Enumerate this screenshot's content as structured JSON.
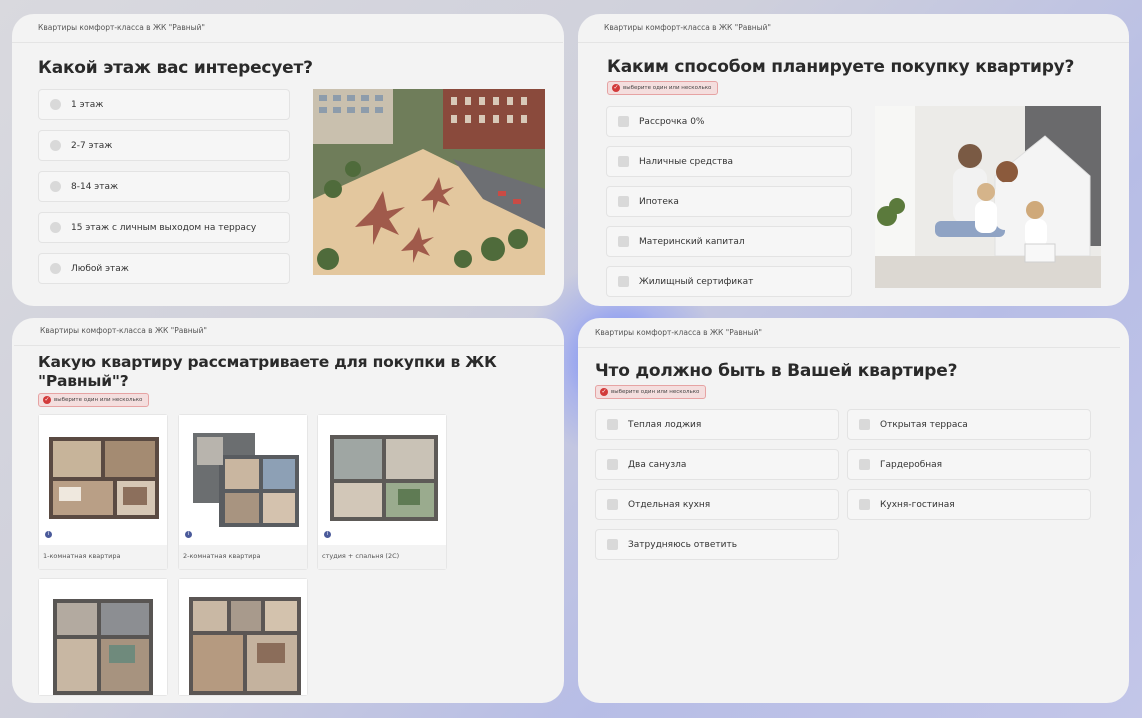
{
  "card1": {
    "breadcrumb": "Квартиры комфорт-класса в ЖК \"Равный\"",
    "title": "Какой этаж вас интересует?",
    "options": [
      "1 этаж",
      "2-7 этаж",
      "8-14 этаж",
      "15 этаж с личным выходом на террасу",
      "Любой этаж"
    ]
  },
  "card2": {
    "breadcrumb": "Квартиры комфорт-класса в ЖК \"Равный\"",
    "title": "Каким способом планируете покупку квартиру?",
    "hint": "выберите один или несколько",
    "options": [
      "Рассрочка 0%",
      "Наличные средства",
      "Ипотека",
      "Материнский капитал",
      "Жилищный сертификат"
    ]
  },
  "card3": {
    "breadcrumb": "Квартиры комфорт-класса в ЖК \"Равный\"",
    "title_line1": "Какую квартиру рассматриваете для покупки в ЖК",
    "title_line2": "\"Равный\"?",
    "hint": "выберите один или несколько",
    "plans": [
      "1-комнатная квартира",
      "2-комнатная квартира",
      "студия + спальня (2С)"
    ]
  },
  "card4": {
    "breadcrumb": "Квартиры комфорт-класса в ЖК \"Равный\"",
    "title": "Что должно быть в Вашей квартире?",
    "hint": "выберите один или несколько",
    "options_left": [
      "Теплая лоджия",
      "Два санузла",
      "Отдельная кухня",
      "Затрудняюсь ответить"
    ],
    "options_right": [
      "Открытая терраса",
      "Гардеробная",
      "Кухня-гостиная"
    ]
  },
  "colors": {
    "card_bg": "#f3f3f3",
    "hint_bg": "#f4dede",
    "hint_icon": "#d23a3a",
    "accent_glow": "#5c78ff"
  }
}
